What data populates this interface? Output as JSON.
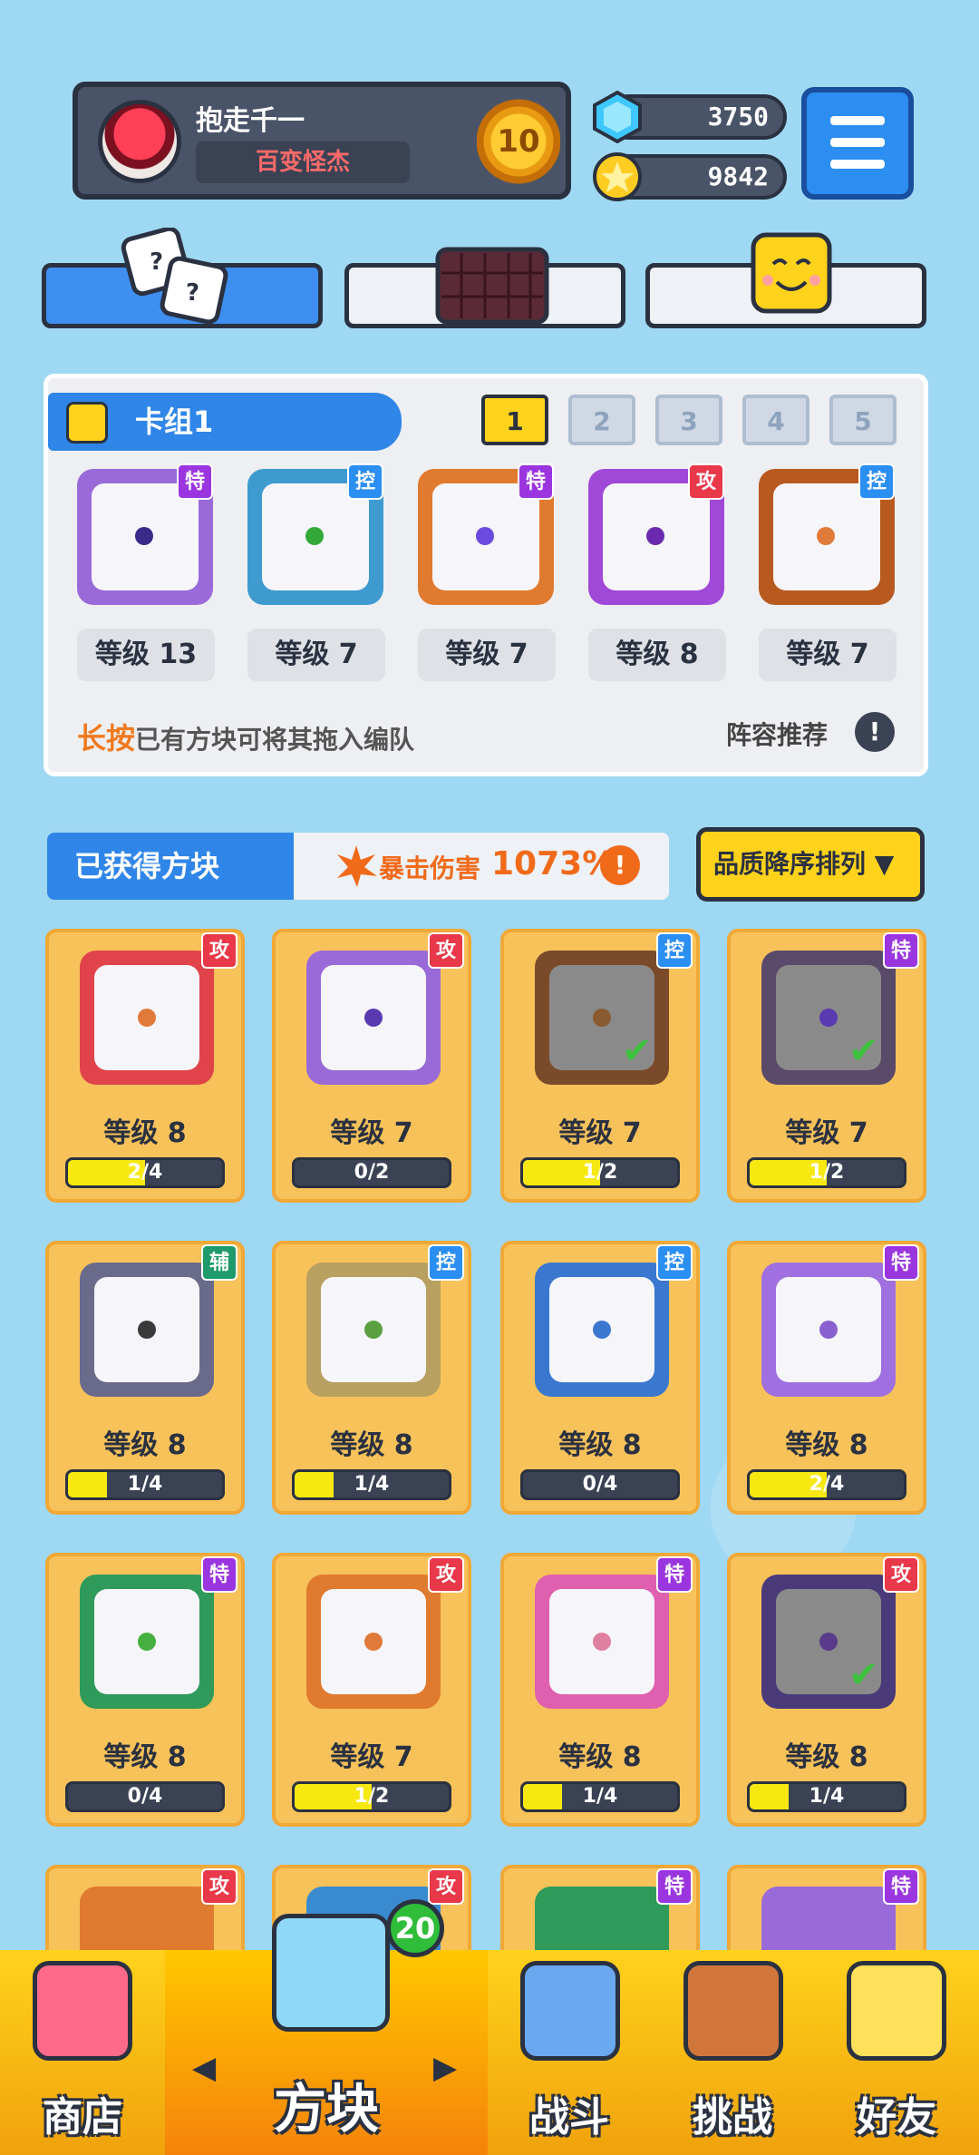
{
  "player": {
    "name": "抱走千一",
    "title": "百变怪杰",
    "rank_level": "10"
  },
  "currency": {
    "gems": "3750",
    "coins": "9842"
  },
  "deck": {
    "title": "卡组1",
    "slots": [
      "1",
      "2",
      "3",
      "4",
      "5"
    ],
    "active_slot": "1",
    "dice": [
      {
        "tag": "特",
        "level": "等级 13"
      },
      {
        "tag": "控",
        "level": "等级 7"
      },
      {
        "tag": "特",
        "level": "等级 7"
      },
      {
        "tag": "攻",
        "level": "等级 8"
      },
      {
        "tag": "控",
        "level": "等级 7"
      }
    ],
    "tip_strong": "长按",
    "tip_rest": "已有方块可将其拖入编队",
    "recommend": "阵容推荐",
    "recommend_icon": "!"
  },
  "owned": {
    "title": "已获得方块",
    "crit_label": "暴击伤害",
    "crit_value": "1073%",
    "crit_info_icon": "!",
    "sort_label": "品质降序排列 ▼",
    "cards": [
      {
        "tag": "攻",
        "level": "等级 8",
        "progress": "2/4",
        "fraction": 0.5,
        "checked": false
      },
      {
        "tag": "攻",
        "level": "等级 7",
        "progress": "0/2",
        "fraction": 0.0,
        "checked": false
      },
      {
        "tag": "控",
        "level": "等级 7",
        "progress": "1/2",
        "fraction": 0.5,
        "checked": true
      },
      {
        "tag": "特",
        "level": "等级 7",
        "progress": "1/2",
        "fraction": 0.5,
        "checked": true
      },
      {
        "tag": "辅",
        "level": "等级 8",
        "progress": "1/4",
        "fraction": 0.25,
        "checked": false
      },
      {
        "tag": "控",
        "level": "等级 8",
        "progress": "1/4",
        "fraction": 0.25,
        "checked": false
      },
      {
        "tag": "控",
        "level": "等级 8",
        "progress": "0/4",
        "fraction": 0.0,
        "checked": false
      },
      {
        "tag": "特",
        "level": "等级 8",
        "progress": "2/4",
        "fraction": 0.5,
        "checked": false
      },
      {
        "tag": "特",
        "level": "等级 8",
        "progress": "0/4",
        "fraction": 0.0,
        "checked": false
      },
      {
        "tag": "攻",
        "level": "等级 7",
        "progress": "1/2",
        "fraction": 0.5,
        "checked": false
      },
      {
        "tag": "特",
        "level": "等级 8",
        "progress": "1/4",
        "fraction": 0.25,
        "checked": false
      },
      {
        "tag": "攻",
        "level": "等级 8",
        "progress": "1/4",
        "fraction": 0.25,
        "checked": true
      }
    ],
    "partial_tags": [
      "攻",
      "攻",
      "特",
      "特"
    ]
  },
  "nav": {
    "shop": "商店",
    "dice": "方块",
    "dice_badge": "20",
    "battle": "战斗",
    "challenge": "挑战",
    "friends": "好友",
    "left_arrow": "◀",
    "right_arrow": "▶"
  },
  "colors": {
    "accent_blue": "#2f86e8",
    "accent_yellow": "#ffd21c",
    "tag_attack": "#e8384a",
    "tag_control": "#2b8ef2",
    "tag_special": "#9a35e0",
    "tag_support": "#1f9a6a"
  },
  "icons": {
    "gem": "gem-icon",
    "coin": "coin-icon",
    "menu": "hamburger-icon",
    "edit": "pencil-icon",
    "crit": "burst-icon",
    "check": "checkmark-icon"
  }
}
